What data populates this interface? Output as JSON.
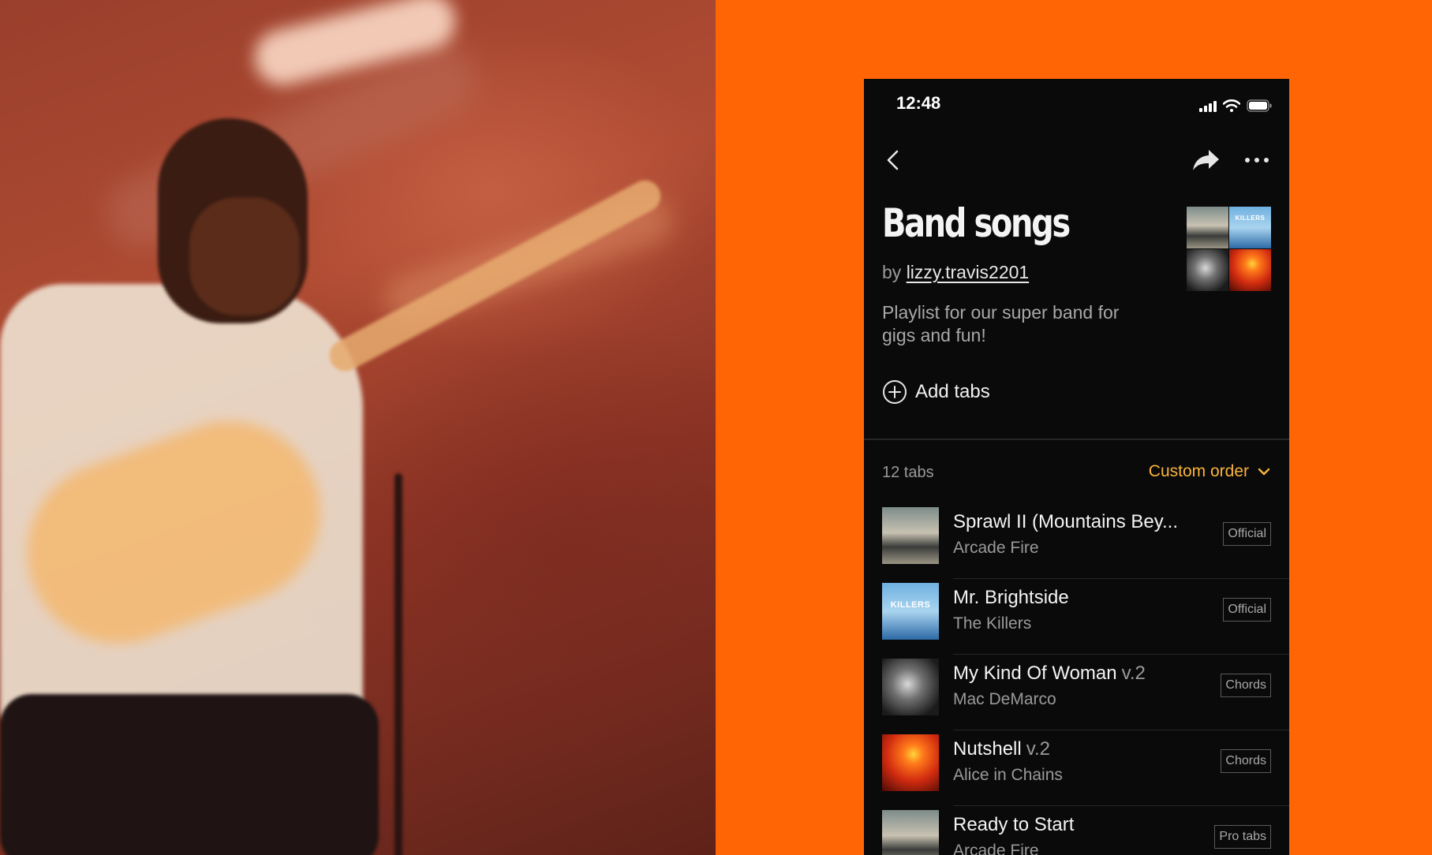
{
  "status_bar": {
    "time": "12:48"
  },
  "nav": {
    "back_icon": "chevron-left-icon",
    "share_icon": "share-arrow-icon",
    "more_icon": "ellipsis-icon"
  },
  "playlist": {
    "title": "Band songs",
    "by_prefix": "by",
    "author": "lizzy.travis2201",
    "description": "Playlist for our super band for gigs and fun!",
    "add_tabs_label": "Add tabs",
    "cover_killers_text": "KILLERS"
  },
  "list_header": {
    "count": "12 tabs",
    "sort_label": "Custom order"
  },
  "tabs": [
    {
      "title": "Sprawl II (Mountains Bey...",
      "version": "",
      "artist": "Arcade Fire",
      "badge": "Official",
      "thumb": "suburbs"
    },
    {
      "title": "Mr. Brightside",
      "version": "",
      "artist": "The Killers",
      "badge": "Official",
      "thumb": "killers",
      "thumb_text": "KILLERS"
    },
    {
      "title": "My Kind Of Woman",
      "version": "v.2",
      "artist": "Mac DeMarco",
      "badge": "Chords",
      "thumb": "demarco"
    },
    {
      "title": "Nutshell",
      "version": "v.2",
      "artist": "Alice in Chains",
      "badge": "Chords",
      "thumb": "jar"
    },
    {
      "title": "Ready to Start",
      "version": "",
      "artist": "Arcade Fire",
      "badge": "Pro tabs",
      "thumb": "suburbs"
    }
  ],
  "colors": {
    "background": "#ff6405",
    "screen": "#0a0a0a",
    "accent": "#f9b43c"
  }
}
